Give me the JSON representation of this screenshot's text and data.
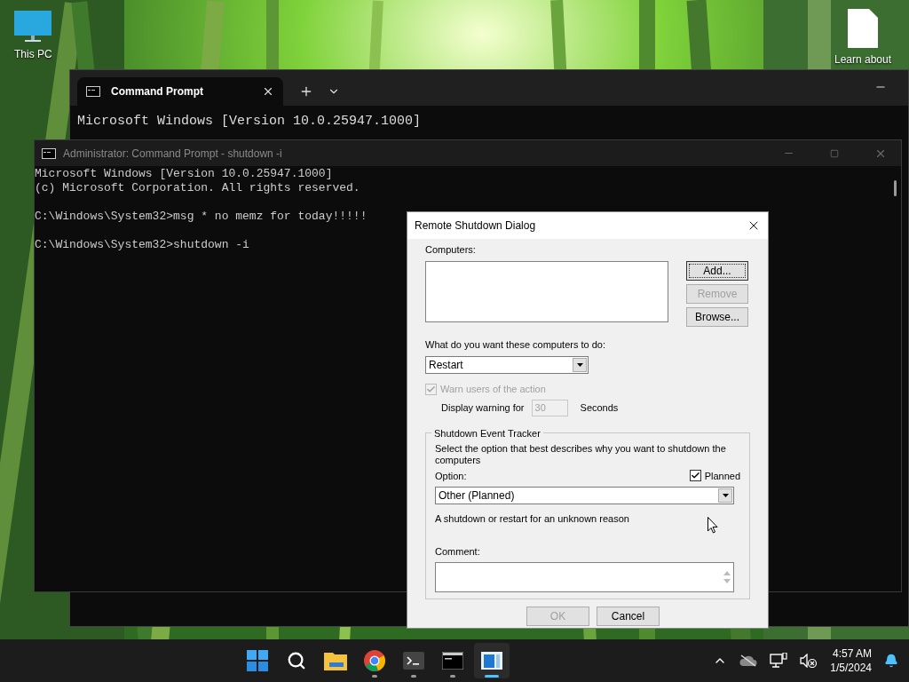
{
  "desktop_icons": [
    {
      "label": "This PC",
      "kind": "computer"
    },
    {
      "label": "Learn about",
      "kind": "file"
    }
  ],
  "terminal": {
    "tabs": [
      {
        "label": "Command Prompt",
        "selected": true
      }
    ],
    "lines": [
      "Microsoft Windows [Version 10.0.25947.1000]"
    ]
  },
  "console": {
    "title": "Administrator: Command Prompt - shutdown -i",
    "blocks": [
      [
        "Microsoft Windows [Version 10.0.25947.1000]",
        "(c) Microsoft Corporation. All rights reserved."
      ],
      [
        "C:\\Windows\\System32>msg * no memz for today!!!!!"
      ],
      [
        "C:\\Windows\\System32>shutdown -i"
      ]
    ]
  },
  "dialog": {
    "title": "Remote Shutdown Dialog",
    "computers_label": "Computers:",
    "side_buttons": [
      {
        "label": "Add...",
        "disabled": false,
        "default": true
      },
      {
        "label": "Remove",
        "disabled": true,
        "default": false
      },
      {
        "label": "Browse...",
        "disabled": false,
        "default": false
      }
    ],
    "action_label": "What do you want these computers to do:",
    "action": "Restart",
    "warn": {
      "label": "Warn users of the action",
      "checked": true,
      "disabled": true
    },
    "warning_prefix": "Display warning for",
    "warning_value": "30",
    "warning_suffix": "Seconds",
    "tracker": {
      "title": "Shutdown Event Tracker",
      "description": "Select the option that best describes why you want to shutdown the computers",
      "option_label": "Option:",
      "planned": {
        "label": "Planned",
        "checked": true
      },
      "option": "Other (Planned)",
      "reason": "A shutdown or restart for an unknown reason",
      "comment_label": "Comment:"
    },
    "footer_buttons": [
      {
        "label": "OK",
        "disabled": true
      },
      {
        "label": "Cancel",
        "disabled": false
      }
    ]
  },
  "taskbar": {
    "apps": [
      {
        "kind": "start",
        "running": false,
        "selected": false
      },
      {
        "kind": "search",
        "running": false,
        "selected": false
      },
      {
        "kind": "folder",
        "running": false,
        "selected": false
      },
      {
        "kind": "browser",
        "running": true,
        "selected": false
      },
      {
        "kind": "terminal",
        "running": true,
        "selected": false
      },
      {
        "kind": "console",
        "running": true,
        "selected": false
      },
      {
        "kind": "window",
        "running": true,
        "selected": true
      }
    ],
    "time": "4:57 AM",
    "date": "1/5/2024"
  }
}
